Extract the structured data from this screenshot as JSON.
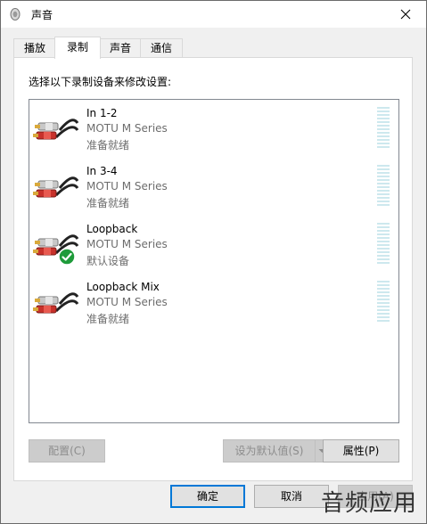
{
  "window": {
    "title": "声音"
  },
  "tabs": [
    {
      "label": "播放",
      "active": false
    },
    {
      "label": "录制",
      "active": true
    },
    {
      "label": "声音",
      "active": false
    },
    {
      "label": "通信",
      "active": false
    }
  ],
  "panel": {
    "instruction": "选择以下录制设备来修改设置:",
    "devices": [
      {
        "name": "In 1-2",
        "model": "MOTU M Series",
        "status": "准备就绪",
        "default": false
      },
      {
        "name": "In 3-4",
        "model": "MOTU M Series",
        "status": "准备就绪",
        "default": false
      },
      {
        "name": "Loopback",
        "model": "MOTU M Series",
        "status": "默认设备",
        "default": true
      },
      {
        "name": "Loopback Mix",
        "model": "MOTU M Series",
        "status": "准备就绪",
        "default": false
      }
    ],
    "buttons": {
      "configure": "配置(C)",
      "set_default": "设为默认值(S)",
      "properties": "属性(P)"
    }
  },
  "footer": {
    "ok": "确定",
    "cancel": "取消",
    "apply": "应用(A)"
  },
  "watermark": "音频应用",
  "colors": {
    "accent": "#0078d7",
    "meter": "#cde8ee",
    "check": "#1e9b3a"
  }
}
